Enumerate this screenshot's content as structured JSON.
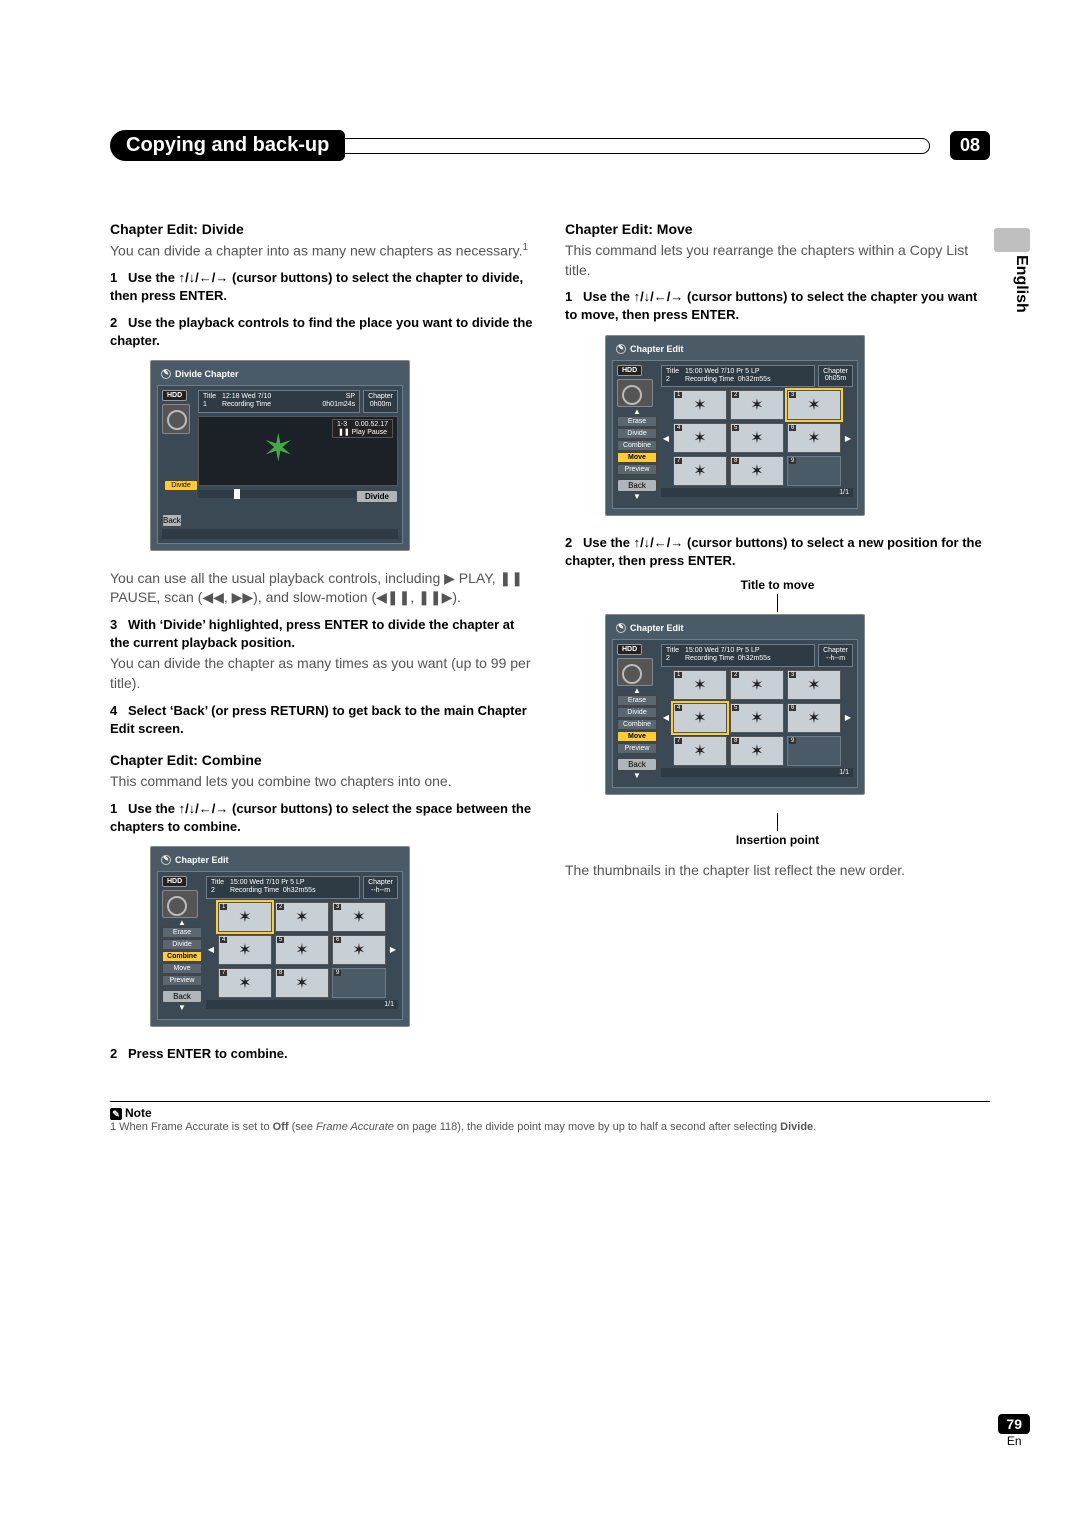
{
  "header": {
    "title": "Copying and back-up",
    "chapter_num": "08"
  },
  "side": {
    "lang": "English",
    "page_num": "79",
    "page_lang": "En"
  },
  "left": {
    "divide": {
      "heading": "Chapter Edit: Divide",
      "intro": "You can divide a chapter into as many new chapters as necessary.",
      "footnote_marker": "1",
      "step1": "Use the ↑/↓/←/→ (cursor buttons) to select the chapter to divide, then press ENTER.",
      "step2": "Use the playback controls to find the place you want to divide the chapter.",
      "after_fig": "You can use all the usual playback controls, including ▶ PLAY, ❚❚ PAUSE, scan (◀◀, ▶▶), and slow-motion (◀❚❚, ❚❚▶).",
      "step3": "With ‘Divide’ highlighted, press ENTER to divide the chapter at the current playback position.",
      "step3_sub": "You can divide the chapter as many times as you want (up to 99 per title).",
      "step4": "Select ‘Back’ (or press RETURN) to get back to the main Chapter Edit screen."
    },
    "combine": {
      "heading": "Chapter Edit: Combine",
      "intro": "This command lets you combine two chapters into one.",
      "step1": "Use the ↑/↓/←/→ (cursor buttons) to select the space between the chapters to combine.",
      "step2": "Press ENTER to combine."
    },
    "fig_divide": {
      "title": "Divide Chapter",
      "hdd": "HDD",
      "meta_title_label": "Title",
      "meta_title_no": "1",
      "meta_date": "12:18 Wed 7/10",
      "meta_rec_label": "Recording Time",
      "sp": "SP",
      "rec_time": "0h01m24s",
      "chapter_label": "Chapter",
      "chapter_time": "0h00m",
      "counter_a": "1-3",
      "counter_b": "0.00.52.17",
      "play_pause": "❚❚ Play Pause",
      "side_divide": "Divide",
      "btn_divide": "Divide",
      "btn_back": "Back"
    },
    "fig_combine": {
      "title": "Chapter Edit",
      "hdd": "HDD",
      "meta_title_label": "Title",
      "meta_title_no": "2",
      "meta_date": "15:00 Wed 7/10  Pr 5  LP",
      "meta_rec_label": "Recording Time",
      "rec_time": "0h32m55s",
      "chapter_label": "Chapter",
      "chapter_time": "--h--m",
      "menu": [
        "Erase",
        "Divide",
        "Combine",
        "Move",
        "Preview"
      ],
      "menu_sel": "Combine",
      "back": "Back",
      "pager": "1/1"
    }
  },
  "right": {
    "move": {
      "heading": "Chapter Edit: Move",
      "intro": "This command lets you rearrange the chapters within a Copy List title.",
      "step1": "Use the ↑/↓/←/→ (cursor buttons) to select the chapter you want to move, then press ENTER.",
      "step2": "Use the ↑/↓/←/→ (cursor buttons) to select a new position for the chapter, then press ENTER.",
      "label_top": "Title to move",
      "label_bottom": "Insertion point",
      "after": "The thumbnails in the chapter list reflect the new order."
    },
    "fig_move1": {
      "title": "Chapter Edit",
      "hdd": "HDD",
      "meta_title_label": "Title",
      "meta_title_no": "2",
      "meta_date": "15:00 Wed 7/10  Pr 5  LP",
      "meta_rec_label": "Recording Time",
      "rec_time": "0h32m55s",
      "chapter_label": "Chapter",
      "chapter_time": "0h05m",
      "menu": [
        "Erase",
        "Divide",
        "Combine",
        "Move",
        "Preview"
      ],
      "menu_sel": "Move",
      "back": "Back",
      "pager": "1/1"
    },
    "fig_move2": {
      "title": "Chapter Edit",
      "hdd": "HDD",
      "meta_title_label": "Title",
      "meta_title_no": "2",
      "meta_date": "15:00 Wed 7/10  Pr 5  LP",
      "meta_rec_label": "Recording Time",
      "rec_time": "0h32m55s",
      "chapter_label": "Chapter",
      "chapter_time": "--h--m",
      "menu": [
        "Erase",
        "Divide",
        "Combine",
        "Move",
        "Preview"
      ],
      "menu_sel": "Move",
      "back": "Back",
      "pager": "1/1"
    }
  },
  "note": {
    "label": "Note",
    "text_pre": "1 When Frame Accurate is set to ",
    "off": "Off",
    "text_mid": " (see ",
    "fa": "Frame Accurate",
    "text_post": " on page 118), the divide point may move by up to half a second after selecting ",
    "divide": "Divide",
    "dot": "."
  }
}
